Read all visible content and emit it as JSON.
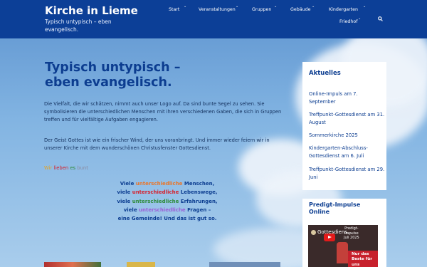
{
  "header": {
    "site_title": "Kirche in Lieme",
    "tagline": "Typisch untypisch – eben evangelisch.",
    "nav": [
      {
        "label": "Start"
      },
      {
        "label": "Veranstaltungen"
      },
      {
        "label": "Gruppen"
      },
      {
        "label": "Gebäude"
      },
      {
        "label": "Kindergarten"
      },
      {
        "label": "Friedhof"
      }
    ]
  },
  "main": {
    "title": "Typisch untypisch – eben evangelisch.",
    "paragraph1": "Die Vielfalt, die wir schätzen, nimmt auch unser Logo auf. Da sind bunte Segel zu sehen. Sie symbolisieren die unterschiedlichen Menschen mit ihren verschiedenen Gaben, die sich in Gruppen treffen und für vielfältige Aufgaben engagieren.",
    "paragraph2": "Der Geist Gottes ist wie ein frischer Wind, der uns voranbringt. Und immer wieder feiern wir in unserer Kirche mit dem wunderschönen Christusfenster Gottesdienst.",
    "tagline_words": [
      "Wir",
      "lieben",
      "es",
      "bunt"
    ],
    "poem": [
      {
        "pre": "Viele ",
        "hl": "unterschiedliche",
        "post": " Menschen,",
        "color": "#e8762b"
      },
      {
        "pre": "viele ",
        "hl": "unterschiedliche",
        "post": " Lebenswege,",
        "color": "#d6212d"
      },
      {
        "pre": "viele ",
        "hl": "unterschiedliche",
        "post": " Erfahrungen,",
        "color": "#2e8b3a"
      },
      {
        "pre": "viele ",
        "hl": "unterschiedliche",
        "post": " Fragen –",
        "color": "#9b5fd6"
      }
    ],
    "poem_last": "eine Gemeinde! Und das ist gut so."
  },
  "sidebar": {
    "title": "Aktuelles",
    "items": [
      "Online-Impuls am 7. September",
      "Treffpunkt-Gottesdienst am 31. August",
      "Sommerkirche 2025",
      "Kindergarten-Abschluss-Gottesdienst am 6. Juli",
      "Treffpunkt-Gottesdienst am 29. Juni"
    ]
  },
  "sidebar2": {
    "title": "Predigt-Impulse Online",
    "video_title": "Gottesdiens...",
    "thumb_text": "Predigt-\nImpulse\nJuli 2025",
    "banner": "Nur das Beste für uns"
  },
  "colors": {
    "header_bg": "#0c3f97",
    "title_blue": "#0c3d90",
    "tag_colors": [
      "#e8a21b",
      "#d6212d",
      "#2e8b3a",
      "#9b5fd6"
    ]
  }
}
